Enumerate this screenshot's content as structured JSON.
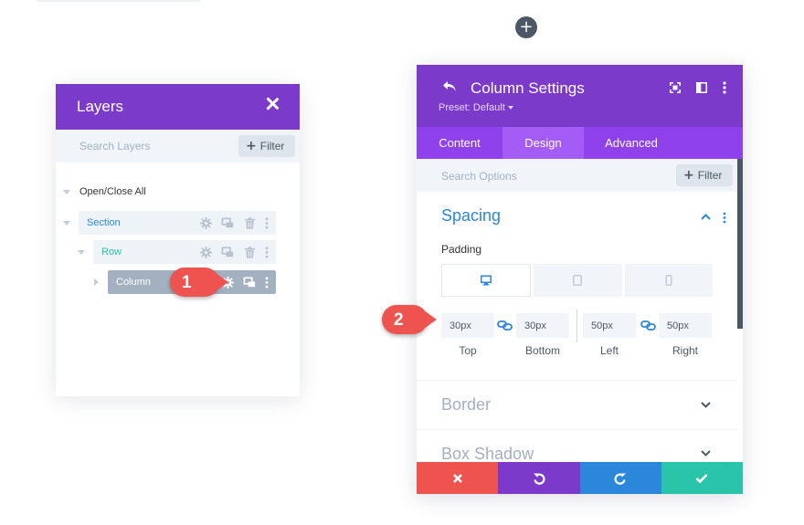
{
  "add_button": {
    "icon": "plus-icon"
  },
  "layers": {
    "title": "Layers",
    "search_placeholder": "Search Layers",
    "filter_label": "Filter",
    "open_close_all": "Open/Close All",
    "items": [
      {
        "label": "Section",
        "color": "#2b87da"
      },
      {
        "label": "Row",
        "color": "#29c4a9"
      },
      {
        "label": "Column",
        "color": "#ffffff"
      }
    ]
  },
  "markers": {
    "one": "1",
    "two": "2"
  },
  "settings": {
    "title": "Column Settings",
    "preset": "Preset: Default",
    "tabs": [
      "Content",
      "Design",
      "Advanced"
    ],
    "active_tab": "Design",
    "search_placeholder": "Search Options",
    "filter_label": "Filter",
    "sections": {
      "spacing": "Spacing",
      "border": "Border",
      "box_shadow": "Box Shadow"
    },
    "padding": {
      "label": "Padding",
      "devices": [
        "desktop-icon",
        "tablet-icon",
        "phone-icon"
      ],
      "fields": [
        {
          "value": "30px",
          "label": "Top"
        },
        {
          "value": "30px",
          "label": "Bottom"
        },
        {
          "value": "50px",
          "label": "Left"
        },
        {
          "value": "50px",
          "label": "Right"
        }
      ]
    },
    "footer": [
      "cancel-icon",
      "undo-icon",
      "redo-icon",
      "save-icon"
    ]
  },
  "colors": {
    "purple": "#7b3ac9",
    "tab_purple": "#8f42ec",
    "blue": "#2b87da",
    "teal": "#29c4a9",
    "red": "#ef5350",
    "gray": "#a2b0c0"
  }
}
